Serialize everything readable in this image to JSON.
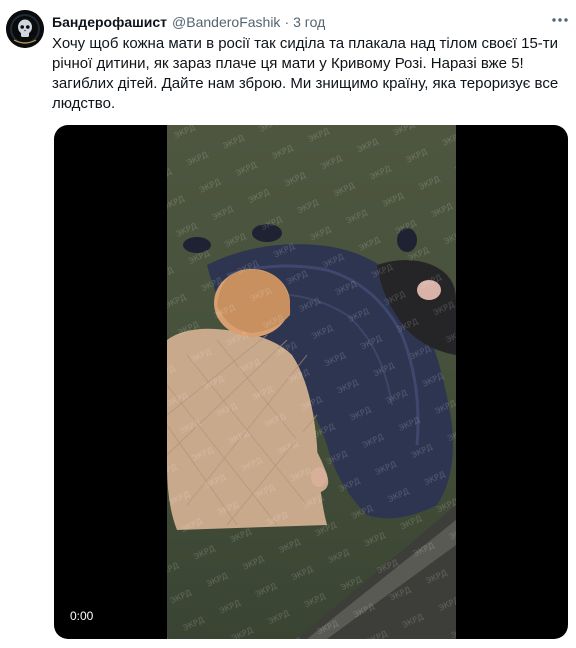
{
  "author": {
    "display_name": "Бандерофашист",
    "handle": "@BanderoFashik",
    "separator": "·",
    "time": "3 год",
    "avatar_icon": "skull-emblem-icon"
  },
  "more_icon": "more-horizontal-icon",
  "tweet_text": [
    "Хочу щоб кожна мати в росії так сиділа та плакала над тілом своєї 15-ти",
    "річної дитини, як зараз плаче ця мати у Кривому Розі. Наразі вже 5!",
    "загиблих дітей. Дайте нам зброю. Ми знищимо країну, яка тероризує все",
    "людство."
  ],
  "media": {
    "type": "video",
    "timestamp": "0:00",
    "watermark": "ЭКРД"
  },
  "colors": {
    "text_primary": "#0f1419",
    "text_secondary": "#536471",
    "media_background": "#000000"
  }
}
